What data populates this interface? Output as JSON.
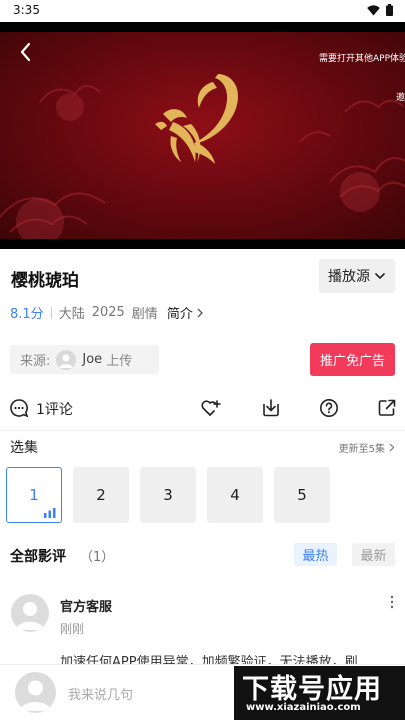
{
  "status_bar": {
    "time": "3:35"
  },
  "player": {
    "hint_text": "需要打开其他APP体验",
    "hint_text_2": "邀"
  },
  "video": {
    "title": "樱桃琥珀",
    "source_button": "播放源",
    "score": "8.1分",
    "region": "大陆",
    "year": "2025",
    "genre": "剧情",
    "intro_label": "简介"
  },
  "uploader": {
    "prefix": "来源:",
    "name": "Joe",
    "suffix": "上传"
  },
  "promo_button": "推广免广告",
  "actions": {
    "comment_count": "1评论"
  },
  "episodes": {
    "title": "选集",
    "update_text": "更新至5集",
    "items": [
      "1",
      "2",
      "3",
      "4",
      "5"
    ],
    "active": "1"
  },
  "reviews": {
    "title": "全部影评",
    "count": "（1）",
    "sort_hot": "最热",
    "sort_new": "最新",
    "comment": {
      "author": "官方客服",
      "time": "刚刚",
      "text": "加速任何APP使用异常，加频繁验证，无法播放，刷"
    }
  },
  "bottom_bar": {
    "placeholder": "我来说几句"
  },
  "watermark": {
    "main": "下载号应用",
    "sub": "www.xiazainiao.com"
  },
  "colors": {
    "accent": "#3b82f6",
    "promo": "#f23b5a",
    "player_bg": "#6a0910",
    "phoenix": "#e2b55a"
  }
}
